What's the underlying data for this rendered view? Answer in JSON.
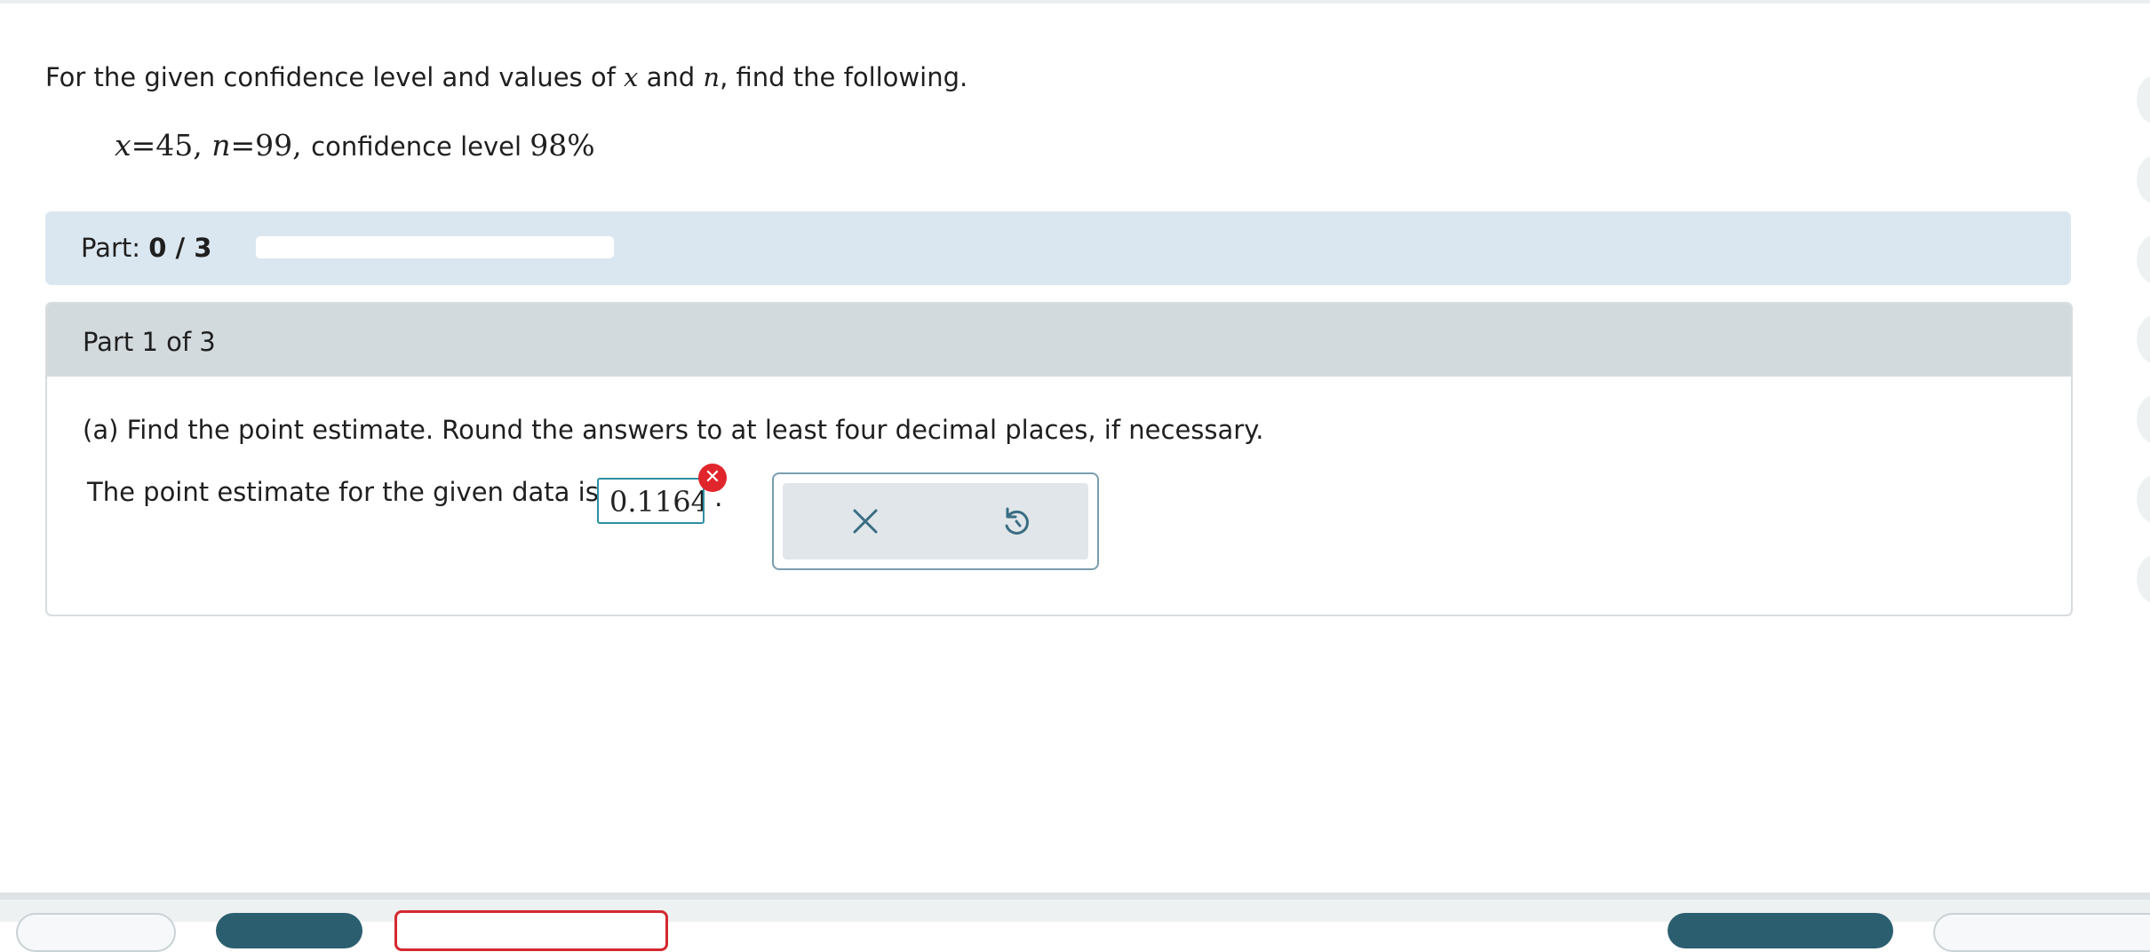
{
  "problem": {
    "intro_before": "For the given confidence level and values of ",
    "var_x": "x",
    "and_word": " and ",
    "var_n": "n",
    "intro_after": ", find the following.",
    "given_x": "x",
    "given_x_value": "=45, ",
    "given_n": "n",
    "given_n_value": "=99, ",
    "given_conf_label": "confidence level ",
    "given_conf_value": "98%"
  },
  "progress": {
    "label": "Part: ",
    "value": "0 / 3",
    "fraction": 0
  },
  "part": {
    "header": "Part 1 of 3",
    "question": "(a) Find the point estimate. Round the answers to at least four decimal places, if necessary.",
    "answer_prefix": "The point estimate for the given data is",
    "answer_value": "0.1164",
    "answer_suffix": ".",
    "answer_status": "incorrect"
  },
  "tools": {
    "clear_icon": "close-icon",
    "undo_icon": "undo-icon"
  },
  "colors": {
    "part_bar": "#dbe7f0",
    "error": "#e0262c",
    "input_border": "#2d8fa3",
    "nav_filled": "#2b5f70"
  }
}
